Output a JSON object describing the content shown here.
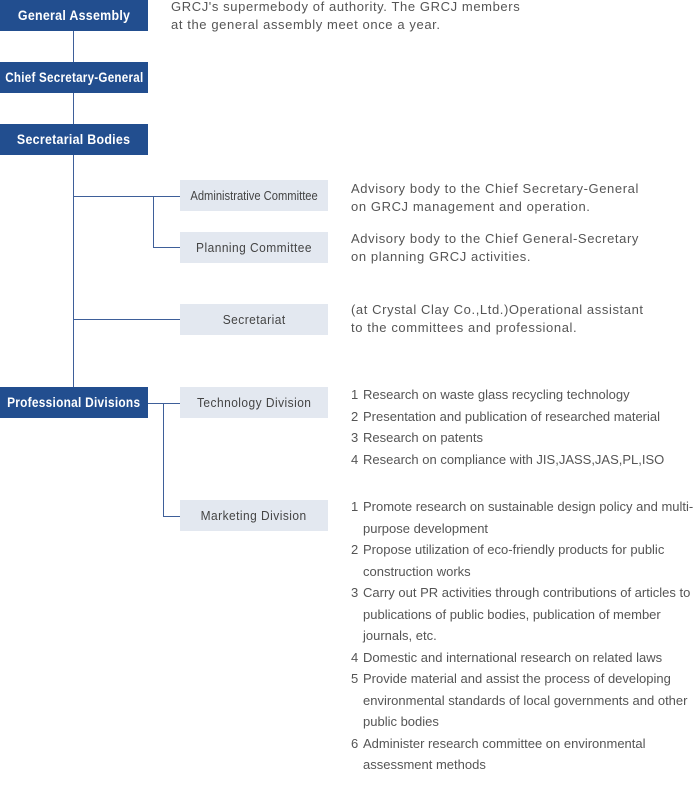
{
  "colors": {
    "primary_box": "#224e8f",
    "secondary_box": "#e3e8f0",
    "connector": "#3e5f99",
    "text": "#555555"
  },
  "nodes": {
    "general_assembly": {
      "label": "General Assembly",
      "description_lines": [
        "GRCJ's supermebody of authority. The GRCJ members",
        "at the general assembly meet once a year."
      ]
    },
    "chief_secretary_general": {
      "label": "Chief Secretary-General"
    },
    "secretarial_bodies": {
      "label": "Secretarial Bodies"
    },
    "administrative_committee": {
      "label": "Administrative Committee",
      "description_lines": [
        "Advisory body to the Chief Secretary-General",
        "on GRCJ management and operation."
      ]
    },
    "planning_committee": {
      "label": "Planning Committee",
      "description_lines": [
        "Advisory body to the Chief General-Secretary",
        "on planning GRCJ activities."
      ]
    },
    "secretariat": {
      "label": "Secretariat",
      "description_lines": [
        "(at Crystal Clay Co.,Ltd.)Operational assistant",
        "to the committees and professional."
      ]
    },
    "professional_divisions": {
      "label": "Professional Divisions"
    },
    "technology_division": {
      "label": "Technology Division",
      "items": [
        {
          "num": "1",
          "text": "Research on waste glass recycling technology"
        },
        {
          "num": "2",
          "text": "Presentation and publication of researched material"
        },
        {
          "num": "3",
          "text": "Research on patents"
        },
        {
          "num": "4",
          "text": "Research on compliance with JIS,JASS,JAS,PL,ISO"
        }
      ]
    },
    "marketing_division": {
      "label": "Marketing Division",
      "items": [
        {
          "num": "1",
          "text": "Promote research on sustainable design policy and multi-purpose development"
        },
        {
          "num": "2",
          "text": "Propose utilization of eco-friendly products for public construction works"
        },
        {
          "num": "3",
          "text": "Carry out PR activities through contributions of articles to publications of public bodies, publication of member journals, etc."
        },
        {
          "num": "4",
          "text": "Domestic and international research on related laws"
        },
        {
          "num": "5",
          "text": "Provide material and assist the process of developing environmental standards of local governments and other public bodies"
        },
        {
          "num": "6",
          "text": "Administer research committee on environmental assessment methods"
        }
      ]
    }
  }
}
